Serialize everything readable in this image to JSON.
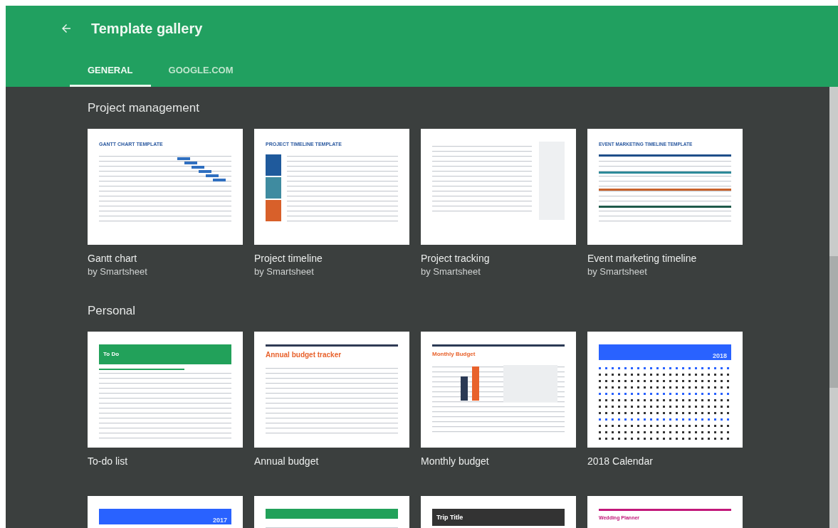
{
  "header": {
    "title": "Template gallery"
  },
  "tabs": [
    {
      "label": "GENERAL",
      "selected": true
    },
    {
      "label": "GOOGLE.COM",
      "selected": false
    }
  ],
  "sections": [
    {
      "title": "Project management",
      "templates": [
        {
          "name": "Gantt chart",
          "author": "by Smartsheet",
          "kind": "gantt",
          "heading": "GANTT CHART TEMPLATE"
        },
        {
          "name": "Project timeline",
          "author": "by Smartsheet",
          "kind": "timeline",
          "heading": "PROJECT TIMELINE TEMPLATE"
        },
        {
          "name": "Project tracking",
          "author": "by Smartsheet",
          "kind": "tracking"
        },
        {
          "name": "Event marketing timeline",
          "author": "by Smartsheet",
          "kind": "event",
          "heading": "EVENT MARKETING TIMELINE TEMPLATE"
        }
      ]
    },
    {
      "title": "Personal",
      "templates": [
        {
          "name": "To-do list",
          "kind": "todo",
          "heading": "To Do"
        },
        {
          "name": "Annual budget",
          "kind": "annual",
          "heading": "Annual budget tracker"
        },
        {
          "name": "Monthly budget",
          "kind": "monthly",
          "heading": "Monthly Budget"
        },
        {
          "name": "2018 Calendar",
          "kind": "calendar",
          "heading": "2018"
        },
        {
          "kind": "calendar",
          "heading": "2017"
        },
        {
          "kind": "schedule"
        },
        {
          "kind": "trip",
          "heading": "Trip Title"
        },
        {
          "kind": "wedding",
          "heading": "Wedding Planner"
        }
      ]
    }
  ]
}
